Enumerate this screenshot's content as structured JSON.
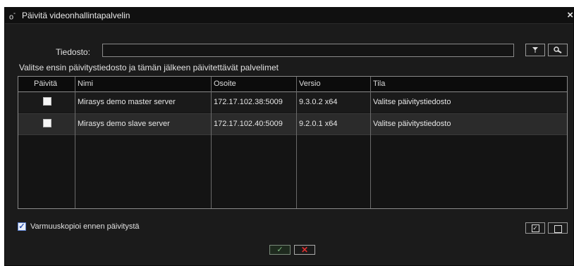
{
  "window": {
    "title": "Päivitä videonhallintapalvelin",
    "close_glyph": "×",
    "app_icon": "gear-icon"
  },
  "file": {
    "label": "Tiedosto:",
    "value": "",
    "placeholder": "",
    "browse_icon": "filter-icon",
    "search_icon": "search-icon"
  },
  "instruction": "Valitse ensin päivitystiedosto ja tämän jälkeen päivitettävät palvelimet",
  "table": {
    "columns": [
      "Päivitä",
      "Nimi",
      "Osoite",
      "Versio",
      "Tila"
    ],
    "rows": [
      {
        "selected": false,
        "name": "Mirasys demo master server",
        "address": "172.17.102.38:5009",
        "version": "9.3.0.2 x64",
        "status": "Valitse päivitystiedosto"
      },
      {
        "selected": false,
        "name": "Mirasys demo slave server",
        "address": "172.17.102.40:5009",
        "version": "9.2.0.1 x64",
        "status": "Valitse päivitystiedosto"
      }
    ]
  },
  "backup": {
    "checked": true,
    "label": "Varmuuskopioi ennen päivitystä"
  },
  "select_all_icon": "checkbox-checked-icon",
  "select_none_icon": "checkbox-empty-icon",
  "ok_icon": "checkmark-icon",
  "cancel_icon": "x-icon",
  "colors": {
    "background": "#1b1b1b",
    "ok": "#7fb87f",
    "cancel": "#e03030"
  }
}
